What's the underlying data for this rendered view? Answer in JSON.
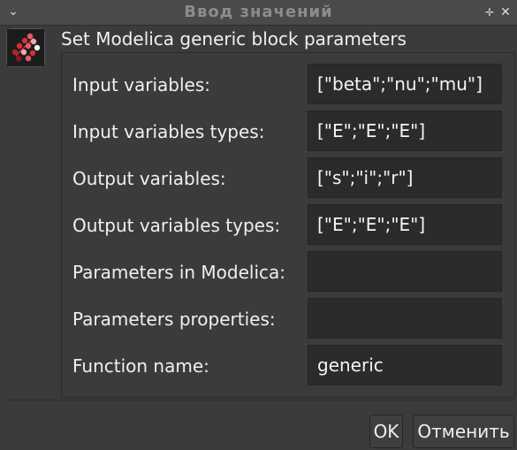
{
  "window": {
    "title": "Ввод значений",
    "menu_glyph": "⌄",
    "pin_glyph": "✛",
    "close_glyph": "✕"
  },
  "dialog": {
    "heading": "Set Modelica generic block parameters",
    "icon": "scilab-modelica-block-icon",
    "rows": [
      {
        "label": "Input variables:",
        "value": "[\"beta\";\"nu\";\"mu\"]"
      },
      {
        "label": "Input variables types:",
        "value": "[\"E\";\"E\";\"E\"]"
      },
      {
        "label": "Output variables:",
        "value": "[\"s\";\"i\";\"r\"]"
      },
      {
        "label": "Output variables types:",
        "value": "[\"E\";\"E\";\"E\"]"
      },
      {
        "label": "Parameters in Modelica:",
        "value": ""
      },
      {
        "label": "Parameters properties:",
        "value": ""
      },
      {
        "label": "Function name:",
        "value": "generic"
      }
    ]
  },
  "buttons": {
    "ok_label": "OK",
    "cancel_label": "Отменить"
  }
}
